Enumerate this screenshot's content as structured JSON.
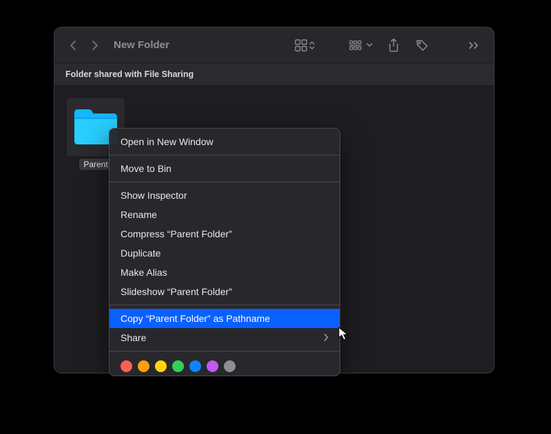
{
  "window": {
    "title": "New Folder",
    "banner": "Folder shared with File Sharing"
  },
  "folder": {
    "name": "Parent"
  },
  "context_menu": {
    "items": [
      "Open in New Window",
      "Move to Bin",
      "Show Inspector",
      "Rename",
      "Compress “Parent Folder”",
      "Duplicate",
      "Make Alias",
      "Slideshow “Parent Folder”",
      "Copy “Parent Folder” as Pathname",
      "Share"
    ]
  },
  "tag_colors": [
    "#ff5f57",
    "#ffbd2e",
    "#ffd60a",
    "#30d158",
    "#0a84ff",
    "#bf5af2",
    "#8e8e93"
  ]
}
